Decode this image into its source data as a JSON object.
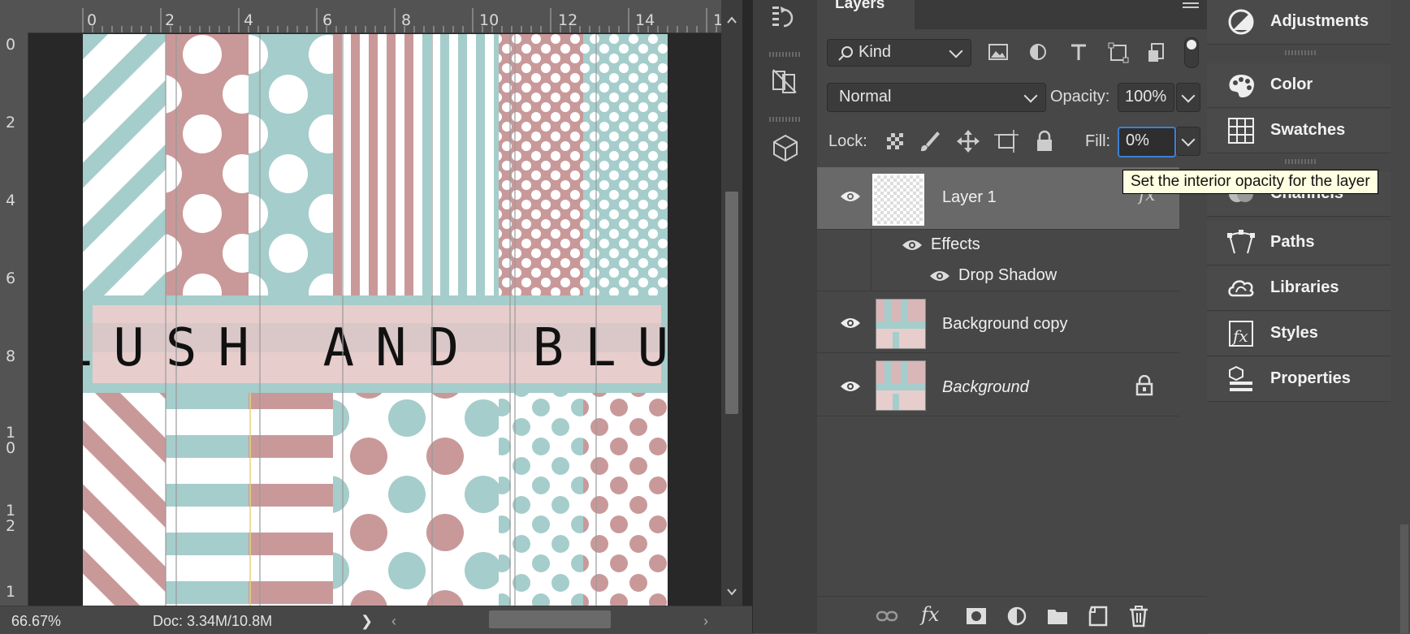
{
  "ruler": {
    "top_labels": [
      "0",
      "2",
      "4",
      "6",
      "8",
      "10",
      "12",
      "14",
      "1"
    ],
    "left_labels": [
      "0",
      "2",
      "4",
      "6",
      "8",
      "1\n0",
      "1\n2",
      "1"
    ]
  },
  "document": {
    "title_text": "BLUSH AND BLUE",
    "colors": {
      "pink": "#c9999a",
      "teal": "#a5cdcb",
      "pale_pink": "#e8cdcd"
    }
  },
  "status": {
    "zoom": "66.67%",
    "doc_size": "Doc: 3.34M/10.8M"
  },
  "tools": [
    "history-brush-icon",
    "timeline-icon",
    "3d-cube-icon"
  ],
  "layers_panel": {
    "tab_label": "Layers",
    "filter": {
      "label": "Kind"
    },
    "blend_mode": "Normal",
    "opacity_label": "Opacity:",
    "opacity_value": "100%",
    "lock_label": "Lock:",
    "fill_label": "Fill:",
    "fill_value": "0%",
    "layers": [
      {
        "name": "Layer 1",
        "fx": "fx",
        "selected": true
      },
      {
        "name": "Effects"
      },
      {
        "name": "Drop Shadow"
      },
      {
        "name": "Background copy"
      },
      {
        "name": "Background",
        "locked": true
      }
    ]
  },
  "tooltip": "Set the interior opacity for the layer",
  "right_panel": {
    "items": [
      {
        "label": "Adjustments",
        "icon": "adjustments-icon"
      },
      {
        "label": "Color",
        "icon": "color-palette-icon"
      },
      {
        "label": "Swatches",
        "icon": "swatches-grid-icon"
      },
      {
        "label": "Channels",
        "icon": "channels-icon"
      },
      {
        "label": "Paths",
        "icon": "paths-icon"
      },
      {
        "label": "Libraries",
        "icon": "libraries-cloud-icon"
      },
      {
        "label": "Styles",
        "icon": "styles-fx-icon"
      },
      {
        "label": "Properties",
        "icon": "properties-icon"
      }
    ]
  }
}
